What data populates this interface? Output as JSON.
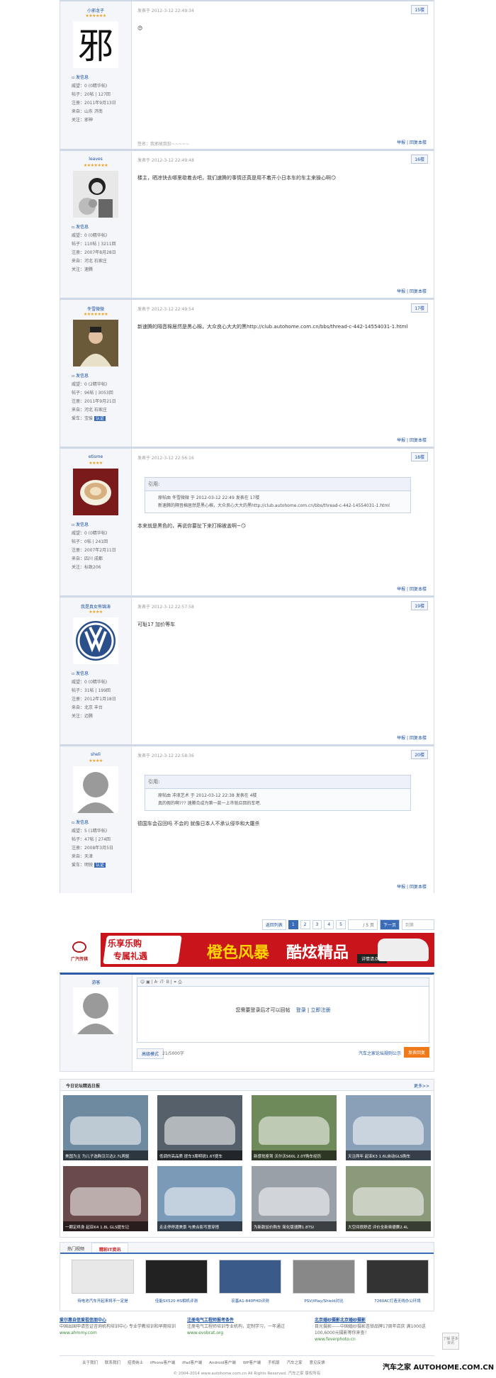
{
  "posts": [
    {
      "user": "小邪龙子",
      "stars": "★★★★★★",
      "avatar": "character-xie",
      "send_msg": "发信息",
      "weiwang": "威望：0 (0精华帖)",
      "posts": "帖子：20帖 | 127回",
      "reg": "注册：2011年9月13日",
      "from": "来自：山东 济南",
      "focus": "关注：邪神",
      "time": "发表于 2012-3-12 22:49:34",
      "floor": "15楼",
      "body": "😊",
      "sig": "签名：我邪故我狂~~~~~",
      "report": "举报",
      "reply": "回复本楼"
    },
    {
      "user": "leaves",
      "stars": "★★★★★★★",
      "avatar": "woman-flowers",
      "send_msg": "发信息",
      "weiwang": "威望：0 (0精华帖)",
      "posts": "帖子：110帖 | 3211回",
      "reg": "注册：2007年8月28日",
      "from": "来自：河北 石家庄",
      "focus": "关注：速腾",
      "time": "发表于 2012-3-12 22:49:48",
      "floor": "16楼",
      "body": "楼主，晒凉快去哪里歇着去吧，我们速腾的事情还真是用不着开小日本车的车主来操心啊😏",
      "report": "举报",
      "reply": "回复本楼"
    },
    {
      "user": "冬雪微微",
      "stars": "★★★★★★★",
      "avatar": "man-portrait",
      "send_msg": "发信息",
      "weiwang": "威望：0 (2精华帖)",
      "posts": "帖子：96帖 | 3053回",
      "reg": "注册：2011年9月21日",
      "from": "来自：河北 石家庄",
      "focus": "爱车：宝骏",
      "badge": "认证",
      "time": "发表于 2012-3-12 22:49:54",
      "floor": "17楼",
      "body": "新速腾的隔音棉居然是黑心棉，大众良心大大的黑http://club.autohome.com.cn/bbs/thread-c-442-14554031-1.html",
      "report": "举报",
      "reply": "回复本楼"
    },
    {
      "user": "etisme",
      "stars": "★★★★",
      "avatar": "coffee-cup",
      "send_msg": "发信息",
      "weiwang": "威望：0 (0精华帖)",
      "posts": "帖子：0帖 | 241回",
      "reg": "注册：2007年2月11日",
      "from": "来自：四川 成都",
      "focus": "关注：标致206",
      "time": "发表于 2012-3-12 22:56:16",
      "floor": "18楼",
      "quote_head": "引用:",
      "quote_by": "原帖由 冬雪微微 于 2012-03-12 22:49 发表在 17楼",
      "quote_text": "新速腾的隔音棉居然是黑心棉，大众良心大大的黑http://club.autohome.com.cn/bbs/thread-c-442-14554031-1.html",
      "body": "本来就是黑色的，再说你要扯下来打棉被盖啊~😏",
      "report": "举报",
      "reply": "回复本楼"
    },
    {
      "user": "我是真女熊锦涛",
      "stars": "★★★★",
      "avatar": "vw-logo",
      "send_msg": "发信息",
      "weiwang": "威望：0 (0精华帖)",
      "posts": "帖子：31帖 | 199回",
      "reg": "注册：2012年1月18日",
      "from": "来自：北京 丰台",
      "focus": "关注：迈腾",
      "time": "发表于 2012-3-12 22:57:58",
      "floor": "19楼",
      "body": "可耻17 加价等车",
      "report": "举报",
      "reply": "回复本楼"
    },
    {
      "user": "sheli",
      "stars": "★★★★",
      "avatar": "default-user",
      "send_msg": "发信息",
      "weiwang": "威望：5 (1精华帖)",
      "posts": "帖子：47帖 | 274回",
      "reg": "注册：2008年3月5日",
      "from": "来自：天津",
      "focus": "爱车：明锐",
      "badge": "认证",
      "time": "发表于 2012-3-12 22:58:36",
      "floor": "20楼",
      "quote_head": "引用:",
      "quote_by": "原帖由 冲浪艺术 于 2012-03-12 22:38 发表在 4楼",
      "quote_text": "真的假的啊??? 速腾合成为第一款一上市就召回的车吧.",
      "body": "德国车会召回吗 不会的 就像日本人不承认侵华和大屠杀",
      "report": "举报",
      "reply": "回复本楼"
    }
  ],
  "pager": {
    "back": "返回列表",
    "p1": "1",
    "p2": "2",
    "p3": "3",
    "p4": "4",
    "p5": "5",
    "jump": "/ 5 页",
    "next": "下一页",
    "goto": "到第"
  },
  "banner": {
    "brand": "广汽传祺",
    "slogan1": "乐享乐购",
    "slogan2": "专属礼遇",
    "title1": "橙色风暴",
    "title2": "酷炫精品",
    "cta": "详情请点击"
  },
  "reply_box": {
    "user": "游客",
    "login_msg": "您需要登录后才可以回帖",
    "login": "登录",
    "reg": "立即注册",
    "mode": "高级模式",
    "count": "21/5000字",
    "rules": "汽车之家论坛规则公示",
    "submit": "发表回复"
  },
  "daily": {
    "title": "今日论坛精选日报",
    "more": "更多>>",
    "tiles": [
      {
        "cap": "美国为主 为儿子选购汉兰达2.7L两驱",
        "color": "#6e8aa0"
      },
      {
        "cap": "低调的高品质 提车3周明锐1.6T提车",
        "color": "#55606a"
      },
      {
        "cap": "新感觉座驾 沃尔沃S60L 2.0T购车经历",
        "color": "#6f8a5a"
      },
      {
        "cap": "天注两年 起亚K3 1.6L自动GLS购车",
        "color": "#8aa0b8"
      },
      {
        "cap": "一颗定终身 起亚K4 1.8L GLS提车记",
        "color": "#6a4a4a"
      },
      {
        "cap": "走走停停渡美景 与美合影写意穿搭",
        "color": "#7a9ab8"
      },
      {
        "cap": "为新款加价购车 简化版速腾1.8TSI",
        "color": "#9aa0a8"
      },
      {
        "cap": "大空间很舒适 评价全新奥德赛2.4L",
        "color": "#8a9a7a"
      }
    ]
  },
  "videos": {
    "tab1": "热门视频",
    "tab2": "精彩IT资讯",
    "items": [
      {
        "t": "待电池汽车开起来将不一定是",
        "color": "#e8e8e8"
      },
      {
        "t": "佳能SX520 HS相机评测",
        "color": "#222"
      },
      {
        "t": "宏基A1-840FHD评测",
        "color": "#3a5a8a"
      },
      {
        "t": "PSV/iPlay/Shield对比",
        "color": "#888"
      },
      {
        "t": "7260AC打造无线办公环境",
        "color": "#333"
      }
    ]
  },
  "ad_links": [
    {
      "a": "爱尔惠自信爱祖信朋中心",
      "d": "中国出国申请签证咨询机构培训中心 专业学教培训和早期培训",
      "u": "www.ahmmy.com"
    },
    {
      "a": "注册电气工程师报考条件",
      "d": "注册电气工程师培训专业机构，定制学习，一年通过",
      "u": "www.evobrat.org"
    },
    {
      "a": "北京婚纱摄影北京婚纱摄影",
      "d": "目光摄影——中国婚纱摄影连锁品牌17周年店庆 满1000送100,6000元摄影等你来查！",
      "u": "www.feverphoto.cn"
    }
  ],
  "footer": {
    "links": [
      "关于我们",
      "联系我们",
      "招贤纳士",
      "iPhone客户端",
      "iPad客户端",
      "Android客户端",
      "WP客户端",
      "手机版",
      "汽车之家",
      "意见反馈"
    ],
    "copy": "© 2004-2014 www.autohome.com.cn All Rights Reserved. 汽车之家 版权所有",
    "brand": "汽车之家 AUTOHOME.COM.CN",
    "side": "了解 更多 资讯"
  }
}
